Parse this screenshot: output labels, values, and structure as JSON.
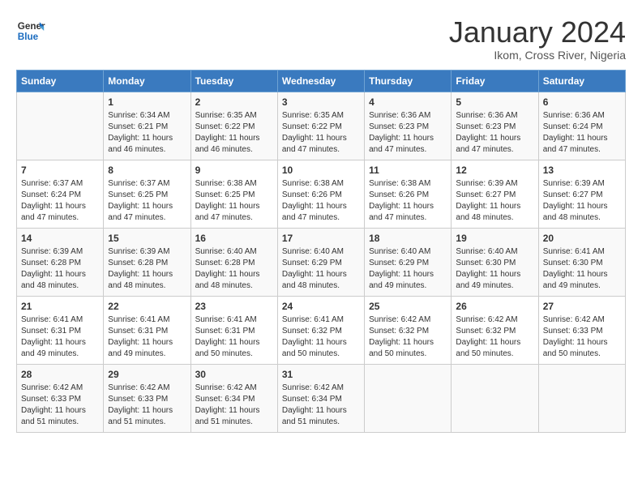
{
  "header": {
    "logo_line1": "General",
    "logo_line2": "Blue",
    "title": "January 2024",
    "subtitle": "Ikom, Cross River, Nigeria"
  },
  "days_of_week": [
    "Sunday",
    "Monday",
    "Tuesday",
    "Wednesday",
    "Thursday",
    "Friday",
    "Saturday"
  ],
  "weeks": [
    [
      {
        "day": "",
        "info": ""
      },
      {
        "day": "1",
        "info": "Sunrise: 6:34 AM\nSunset: 6:21 PM\nDaylight: 11 hours\nand 46 minutes."
      },
      {
        "day": "2",
        "info": "Sunrise: 6:35 AM\nSunset: 6:22 PM\nDaylight: 11 hours\nand 46 minutes."
      },
      {
        "day": "3",
        "info": "Sunrise: 6:35 AM\nSunset: 6:22 PM\nDaylight: 11 hours\nand 47 minutes."
      },
      {
        "day": "4",
        "info": "Sunrise: 6:36 AM\nSunset: 6:23 PM\nDaylight: 11 hours\nand 47 minutes."
      },
      {
        "day": "5",
        "info": "Sunrise: 6:36 AM\nSunset: 6:23 PM\nDaylight: 11 hours\nand 47 minutes."
      },
      {
        "day": "6",
        "info": "Sunrise: 6:36 AM\nSunset: 6:24 PM\nDaylight: 11 hours\nand 47 minutes."
      }
    ],
    [
      {
        "day": "7",
        "info": "Sunrise: 6:37 AM\nSunset: 6:24 PM\nDaylight: 11 hours\nand 47 minutes."
      },
      {
        "day": "8",
        "info": "Sunrise: 6:37 AM\nSunset: 6:25 PM\nDaylight: 11 hours\nand 47 minutes."
      },
      {
        "day": "9",
        "info": "Sunrise: 6:38 AM\nSunset: 6:25 PM\nDaylight: 11 hours\nand 47 minutes."
      },
      {
        "day": "10",
        "info": "Sunrise: 6:38 AM\nSunset: 6:26 PM\nDaylight: 11 hours\nand 47 minutes."
      },
      {
        "day": "11",
        "info": "Sunrise: 6:38 AM\nSunset: 6:26 PM\nDaylight: 11 hours\nand 47 minutes."
      },
      {
        "day": "12",
        "info": "Sunrise: 6:39 AM\nSunset: 6:27 PM\nDaylight: 11 hours\nand 48 minutes."
      },
      {
        "day": "13",
        "info": "Sunrise: 6:39 AM\nSunset: 6:27 PM\nDaylight: 11 hours\nand 48 minutes."
      }
    ],
    [
      {
        "day": "14",
        "info": "Sunrise: 6:39 AM\nSunset: 6:28 PM\nDaylight: 11 hours\nand 48 minutes."
      },
      {
        "day": "15",
        "info": "Sunrise: 6:39 AM\nSunset: 6:28 PM\nDaylight: 11 hours\nand 48 minutes."
      },
      {
        "day": "16",
        "info": "Sunrise: 6:40 AM\nSunset: 6:28 PM\nDaylight: 11 hours\nand 48 minutes."
      },
      {
        "day": "17",
        "info": "Sunrise: 6:40 AM\nSunset: 6:29 PM\nDaylight: 11 hours\nand 48 minutes."
      },
      {
        "day": "18",
        "info": "Sunrise: 6:40 AM\nSunset: 6:29 PM\nDaylight: 11 hours\nand 49 minutes."
      },
      {
        "day": "19",
        "info": "Sunrise: 6:40 AM\nSunset: 6:30 PM\nDaylight: 11 hours\nand 49 minutes."
      },
      {
        "day": "20",
        "info": "Sunrise: 6:41 AM\nSunset: 6:30 PM\nDaylight: 11 hours\nand 49 minutes."
      }
    ],
    [
      {
        "day": "21",
        "info": "Sunrise: 6:41 AM\nSunset: 6:31 PM\nDaylight: 11 hours\nand 49 minutes."
      },
      {
        "day": "22",
        "info": "Sunrise: 6:41 AM\nSunset: 6:31 PM\nDaylight: 11 hours\nand 49 minutes."
      },
      {
        "day": "23",
        "info": "Sunrise: 6:41 AM\nSunset: 6:31 PM\nDaylight: 11 hours\nand 50 minutes."
      },
      {
        "day": "24",
        "info": "Sunrise: 6:41 AM\nSunset: 6:32 PM\nDaylight: 11 hours\nand 50 minutes."
      },
      {
        "day": "25",
        "info": "Sunrise: 6:42 AM\nSunset: 6:32 PM\nDaylight: 11 hours\nand 50 minutes."
      },
      {
        "day": "26",
        "info": "Sunrise: 6:42 AM\nSunset: 6:32 PM\nDaylight: 11 hours\nand 50 minutes."
      },
      {
        "day": "27",
        "info": "Sunrise: 6:42 AM\nSunset: 6:33 PM\nDaylight: 11 hours\nand 50 minutes."
      }
    ],
    [
      {
        "day": "28",
        "info": "Sunrise: 6:42 AM\nSunset: 6:33 PM\nDaylight: 11 hours\nand 51 minutes."
      },
      {
        "day": "29",
        "info": "Sunrise: 6:42 AM\nSunset: 6:33 PM\nDaylight: 11 hours\nand 51 minutes."
      },
      {
        "day": "30",
        "info": "Sunrise: 6:42 AM\nSunset: 6:34 PM\nDaylight: 11 hours\nand 51 minutes."
      },
      {
        "day": "31",
        "info": "Sunrise: 6:42 AM\nSunset: 6:34 PM\nDaylight: 11 hours\nand 51 minutes."
      },
      {
        "day": "",
        "info": ""
      },
      {
        "day": "",
        "info": ""
      },
      {
        "day": "",
        "info": ""
      }
    ]
  ]
}
